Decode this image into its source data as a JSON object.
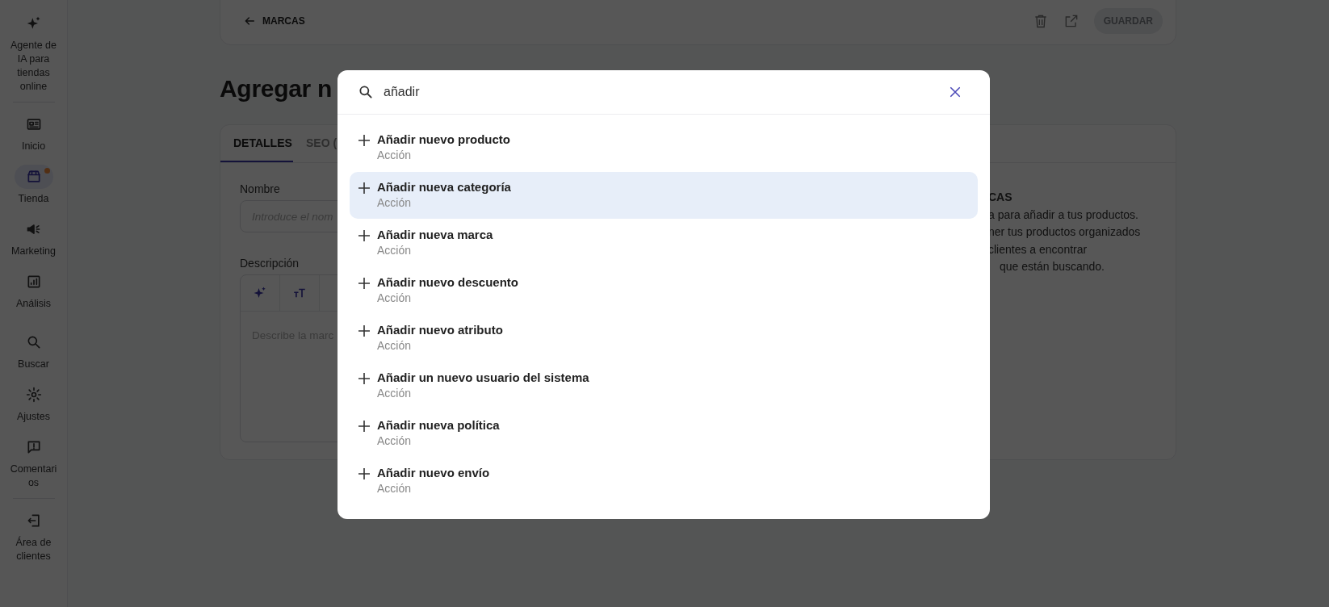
{
  "sidebar": {
    "groups": [
      [
        {
          "label": "Agente de IA para tiendas online",
          "selected": false,
          "notification": false
        }
      ],
      [
        {
          "label": "Inicio",
          "selected": false,
          "notification": false
        },
        {
          "label": "Tienda",
          "selected": true,
          "notification": true
        },
        {
          "label": "Marketing",
          "selected": false,
          "notification": false
        },
        {
          "label": "Análisis",
          "selected": false,
          "notification": false
        }
      ],
      [
        {
          "label": "Buscar",
          "selected": false,
          "notification": false
        },
        {
          "label": "Ajustes",
          "selected": false,
          "notification": false
        },
        {
          "label": "Comentarios",
          "selected": false,
          "notification": false
        }
      ],
      [
        {
          "label": "Área de clientes",
          "selected": false,
          "notification": false
        }
      ]
    ]
  },
  "header": {
    "back_link": "MARCAS",
    "save_button": {
      "label": "GUARDAR",
      "disabled": true
    }
  },
  "page_title": "Agregar n",
  "tabs": [
    {
      "label": "DETALLES",
      "selected": true
    },
    {
      "label": "SEO (",
      "selected": false
    }
  ],
  "form": {
    "name_label": "Nombre",
    "name_placeholder": "Introduce el nom",
    "description_label": "Descripción",
    "description_placeholder": "Describe la marc"
  },
  "info_panel": {
    "heading": "CAS",
    "lines": [
      "a para añadir a tus productos.",
      "ner tus productos organizados",
      "clientes a encontrar",
      "que están buscando."
    ]
  },
  "search_dialog": {
    "value": "añadir",
    "results": [
      {
        "title": "Añadir nuevo producto",
        "subtitle": "Acción",
        "selected": false
      },
      {
        "title": "Añadir nueva categoría",
        "subtitle": "Acción",
        "selected": true
      },
      {
        "title": "Añadir nueva marca",
        "subtitle": "Acción",
        "selected": false
      },
      {
        "title": "Añadir nuevo descuento",
        "subtitle": "Acción",
        "selected": false
      },
      {
        "title": "Añadir nuevo atributo",
        "subtitle": "Acción",
        "selected": false
      },
      {
        "title": "Añadir un nuevo usuario del sistema",
        "subtitle": "Acción",
        "selected": false
      },
      {
        "title": "Añadir nueva política",
        "subtitle": "Acción",
        "selected": false
      },
      {
        "title": "Añadir nuevo envío",
        "subtitle": "Acción",
        "selected": false
      }
    ]
  }
}
